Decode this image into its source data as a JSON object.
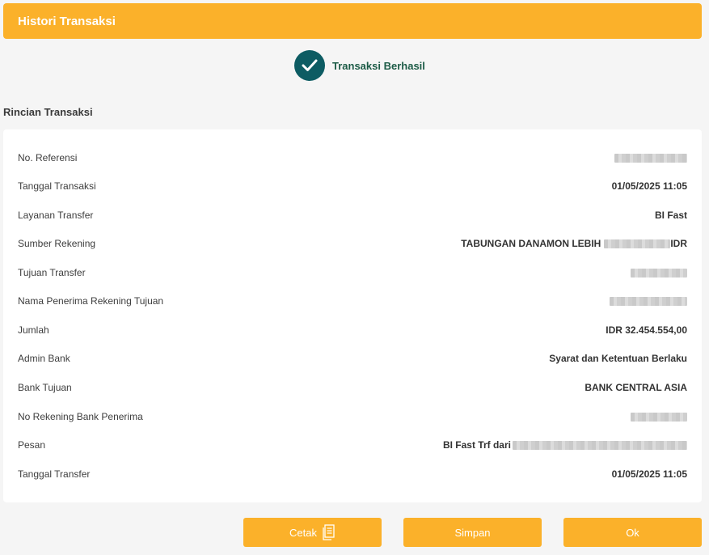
{
  "header": {
    "title": "Histori Transaksi"
  },
  "status": {
    "text": "Transaksi Berhasil",
    "icon": "check-icon"
  },
  "section": {
    "title": "Rincian Transaksi"
  },
  "details": [
    {
      "label": "No. Referensi",
      "value": "",
      "masked": true
    },
    {
      "label": "Tanggal Transaksi",
      "value": "01/05/2025 11:05"
    },
    {
      "label": "Layanan Transfer",
      "value": "BI Fast"
    },
    {
      "label": "Sumber Rekening",
      "value_prefix": "TABUNGAN DANAMON LEBIH",
      "value_suffix": "IDR",
      "masked": true
    },
    {
      "label": "Tujuan Transfer",
      "value": "",
      "masked": true
    },
    {
      "label": "Nama Penerima Rekening Tujuan",
      "value": "",
      "masked": true
    },
    {
      "label": "Jumlah",
      "value": "IDR 32.454.554,00"
    },
    {
      "label": "Admin Bank",
      "value": "Syarat dan Ketentuan Berlaku"
    },
    {
      "label": "Bank Tujuan",
      "value": "BANK CENTRAL ASIA"
    },
    {
      "label": "No Rekening Bank Penerima",
      "value": "",
      "masked": true
    },
    {
      "label": "Pesan",
      "value_prefix": "BI Fast Trf dari",
      "masked": true
    },
    {
      "label": "Tanggal Transfer",
      "value": "01/05/2025 11:05"
    }
  ],
  "buttons": {
    "print_label": "Cetak",
    "save_label": "Simpan",
    "ok_label": "Ok"
  },
  "colors": {
    "accent": "#fbb12a",
    "status_circle": "#0d5c63",
    "status_text": "#1c5b46"
  }
}
